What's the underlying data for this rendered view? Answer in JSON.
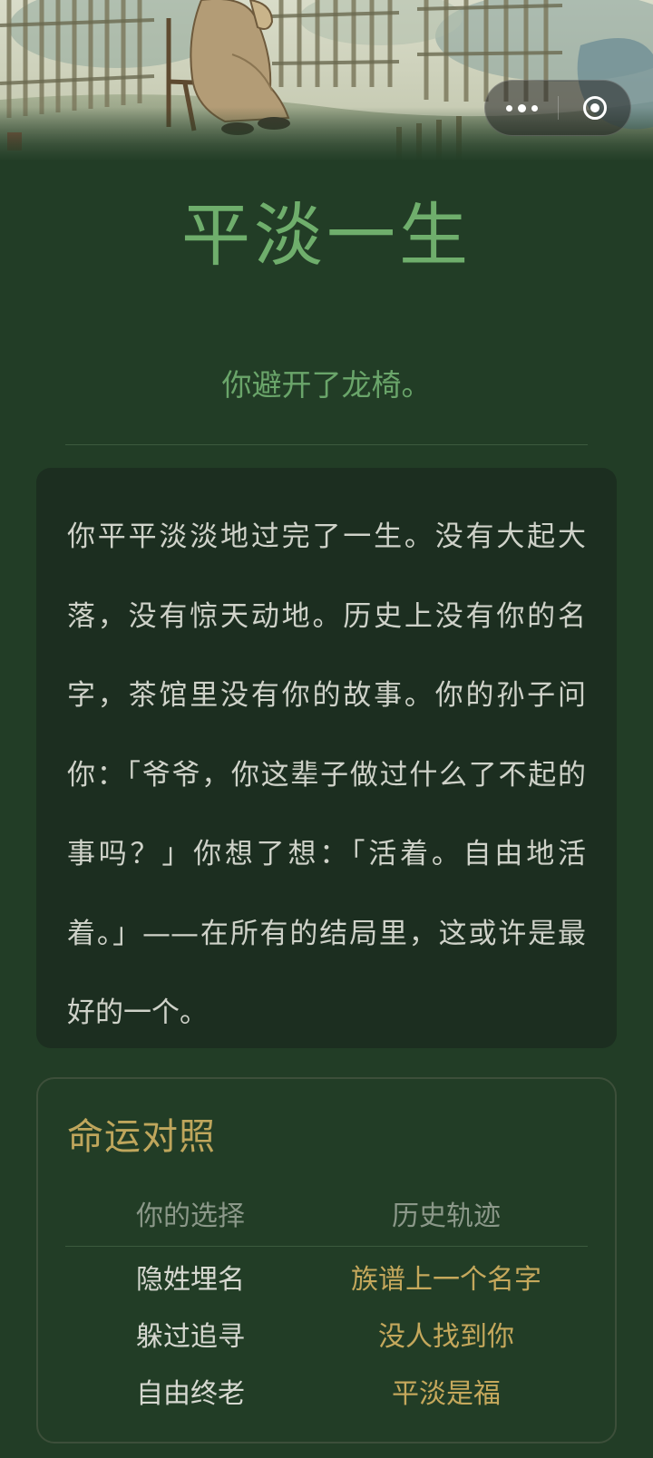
{
  "header": {
    "capsule": {
      "more_icon": "more-dots-icon",
      "close_icon": "record-circle-icon"
    }
  },
  "ending": {
    "title": "平淡一生",
    "subtitle": "你避开了龙椅。",
    "story": "你平平淡淡地过完了一生。没有大起大落，没有惊天动地。历史上没有你的名字，茶馆里没有你的故事。你的孙子问你：「爷爷，你这辈子做过什么了不起的事吗？」你想了想：「活着。自由地活着。」——在所有的结局里，这或许是最好的一个。"
  },
  "fate": {
    "title": "命运对照",
    "headers": [
      "你的选择",
      "历史轨迹"
    ],
    "rows": [
      {
        "choice": "隐姓埋名",
        "history": "族谱上一个名字"
      },
      {
        "choice": "躲过追寻",
        "history": "没人找到你"
      },
      {
        "choice": "自由终老",
        "history": "平淡是福"
      }
    ]
  },
  "colors": {
    "background": "#223d26",
    "title_green": "#6fae6c",
    "card_dark": "#1c2e20",
    "gold": "#c5a85c",
    "text_light": "#d6d8d0"
  }
}
